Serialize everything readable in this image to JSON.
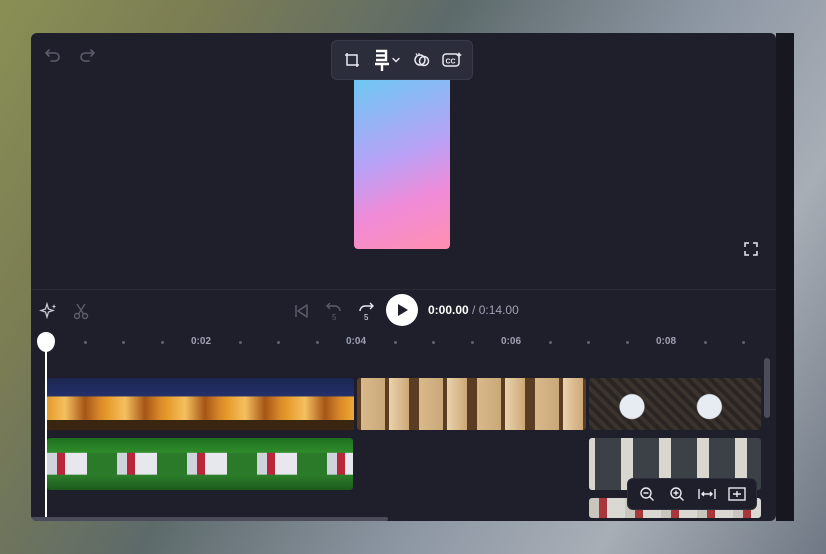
{
  "icons": {
    "undo": "undo-icon",
    "redo": "redo-icon",
    "crop": "crop-icon",
    "text_effect": "text-effect-icon",
    "chevron": "chevron-down-icon",
    "filters": "filters-icon",
    "captions": "captions-icon",
    "fullscreen": "fullscreen-icon",
    "magic": "magic-sparkle-icon",
    "cut": "scissors-icon",
    "skip_start": "skip-to-start-icon",
    "rewind": "rewind-5-icon",
    "forward": "forward-5-icon",
    "play": "play-icon",
    "zoom_out": "zoom-out-icon",
    "zoom_in": "zoom-in-icon",
    "fit": "fit-timeline-icon",
    "expand": "expand-timeline-icon"
  },
  "playback": {
    "rewind_seconds": "5",
    "forward_seconds": "5",
    "current_time": "0:00.00",
    "separator": "/",
    "total_time": "0:14.00"
  },
  "ruler": {
    "labels": [
      "0:02",
      "0:04",
      "0:06",
      "0:08"
    ]
  },
  "colors": {
    "app_background": "#1e1f2a",
    "accent_white": "#ffffff",
    "muted_text": "#9fa2b4",
    "preview_gradient_top": "#6ec8f4",
    "preview_gradient_bottom": "#ff8fb0"
  }
}
